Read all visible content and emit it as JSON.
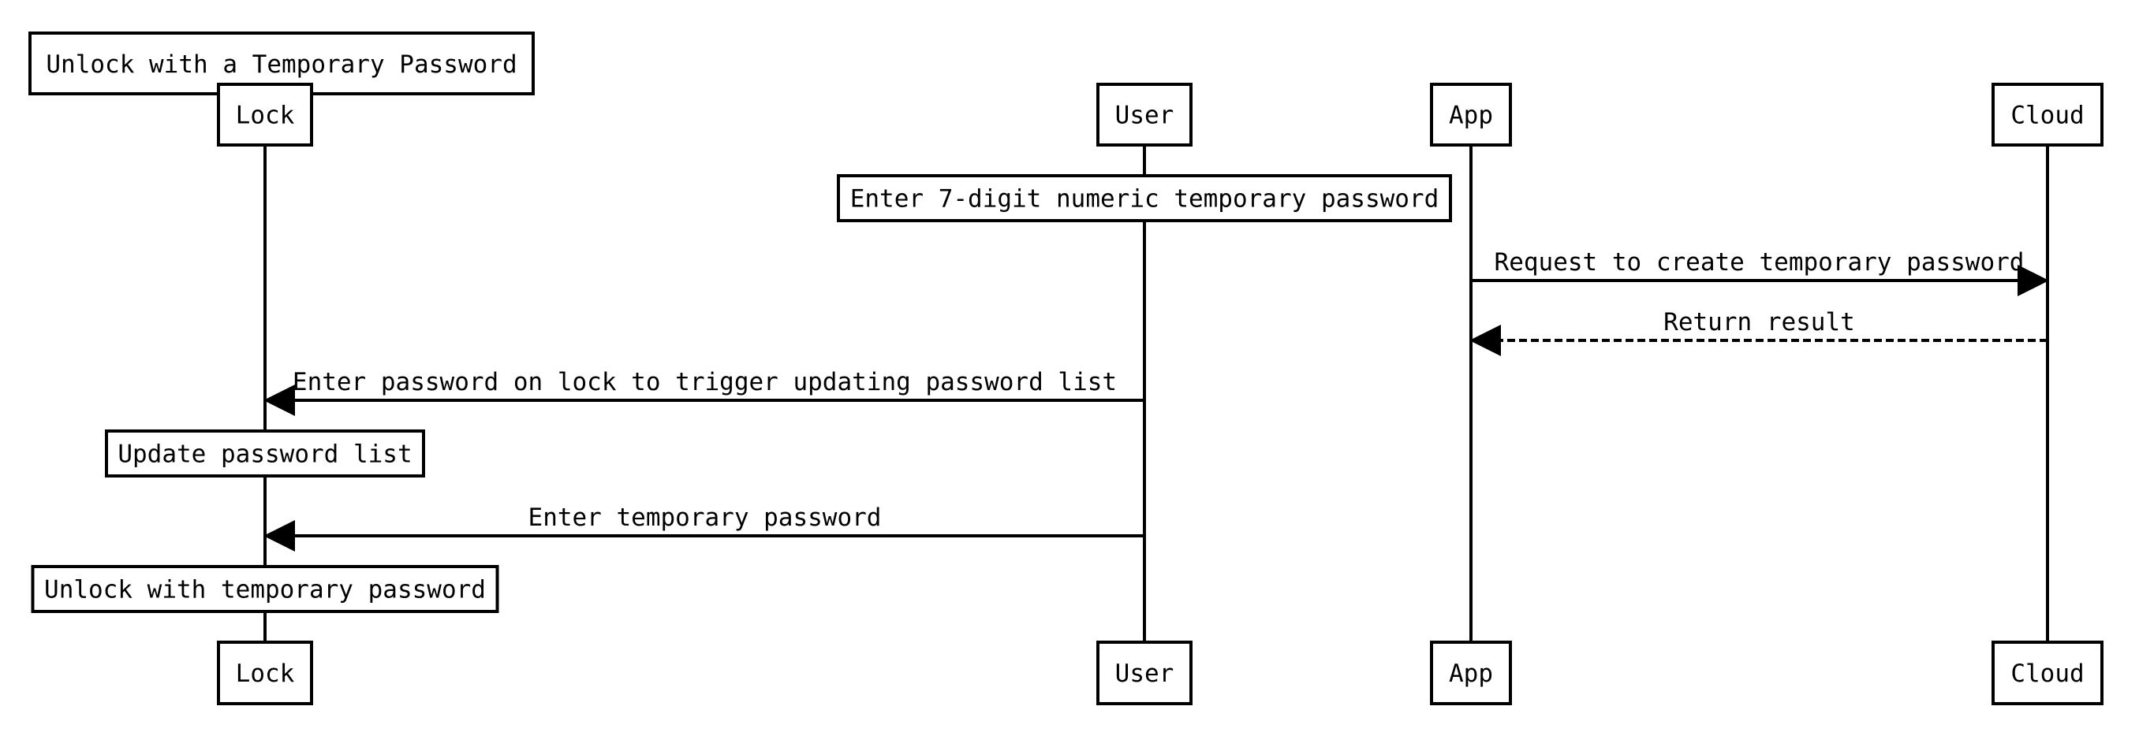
{
  "title": "Unlock with a Temporary Password",
  "colors": {
    "stroke": "#000000",
    "background": "#ffffff",
    "text": "#000000"
  },
  "participants": [
    {
      "id": "lock",
      "label": "Lock"
    },
    {
      "id": "user",
      "label": "User"
    },
    {
      "id": "app",
      "label": "App"
    },
    {
      "id": "cloud",
      "label": "Cloud"
    }
  ],
  "steps": [
    {
      "type": "note",
      "over": "user",
      "text": "Enter 7-digit numeric temporary password"
    },
    {
      "type": "message",
      "from": "app",
      "to": "cloud",
      "style": "solid",
      "text": "Request to create temporary password"
    },
    {
      "type": "message",
      "from": "cloud",
      "to": "app",
      "style": "dashed",
      "text": "Return result"
    },
    {
      "type": "message",
      "from": "user",
      "to": "lock",
      "style": "solid",
      "text": "Enter password on lock to trigger updating password list"
    },
    {
      "type": "note",
      "over": "lock",
      "text": "Update password list"
    },
    {
      "type": "message",
      "from": "user",
      "to": "lock",
      "style": "solid",
      "text": "Enter temporary password"
    },
    {
      "type": "note",
      "over": "lock",
      "text": "Unlock with temporary password"
    }
  ]
}
